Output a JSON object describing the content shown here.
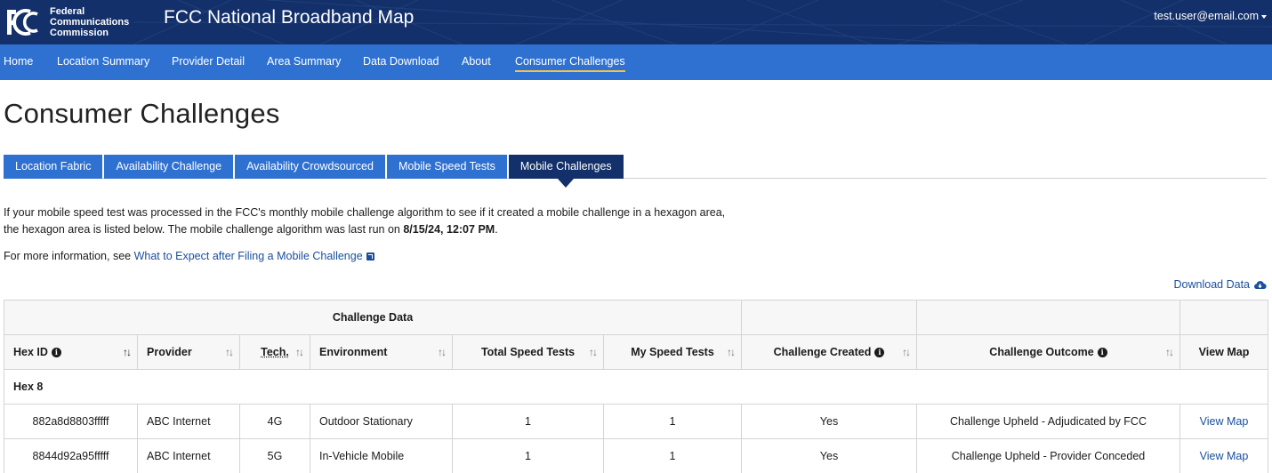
{
  "header": {
    "agency_lines": [
      "Federal",
      "Communications",
      "Commission"
    ],
    "app_title": "FCC National Broadband Map",
    "user_email": "test.user@email.com"
  },
  "nav": [
    {
      "label": "Home"
    },
    {
      "label": "Location Summary"
    },
    {
      "label": "Provider Detail"
    },
    {
      "label": "Area Summary"
    },
    {
      "label": "Data Download"
    },
    {
      "label": "About"
    },
    {
      "label": "Consumer Challenges",
      "active": true
    }
  ],
  "page": {
    "title": "Consumer Challenges",
    "tabs": [
      {
        "label": "Location Fabric"
      },
      {
        "label": "Availability Challenge"
      },
      {
        "label": "Availability Crowdsourced"
      },
      {
        "label": "Mobile Speed Tests"
      },
      {
        "label": "Mobile Challenges",
        "active": true
      }
    ],
    "description_pre": "If your mobile speed test was processed in the FCC's monthly mobile challenge algorithm to see if it created a mobile challenge in a hexagon area, the hexagon area is listed below. The mobile challenge algorithm was last run on ",
    "description_date": "8/15/24, 12:07 PM",
    "description_post": ".",
    "more_info_prefix": "For more information, see ",
    "more_info_link": "What to Expect after Filing a Mobile Challenge",
    "download_label": "Download Data"
  },
  "table": {
    "group_header": "Challenge Data",
    "columns": {
      "hex_id": "Hex ID",
      "provider": "Provider",
      "tech": "Tech.",
      "environment": "Environment",
      "total_speed_tests": "Total Speed Tests",
      "my_speed_tests": "My Speed Tests",
      "challenge_created": "Challenge Created",
      "challenge_outcome": "Challenge Outcome",
      "view_map": "View Map"
    },
    "sort_glyph": "↑↓",
    "group_label": "Hex 8",
    "rows": [
      {
        "hex_id": "882a8d8803fffff",
        "provider": "ABC Internet",
        "tech": "4G",
        "environment": "Outdoor Stationary",
        "total": "1",
        "mine": "1",
        "created": "Yes",
        "outcome": "Challenge Upheld - Adjudicated by FCC",
        "view": "View Map"
      },
      {
        "hex_id": "8844d92a95fffff",
        "provider": "ABC Internet",
        "tech": "5G",
        "environment": "In-Vehicle Mobile",
        "total": "1",
        "mine": "1",
        "created": "Yes",
        "outcome": "Challenge Upheld - Provider Conceded",
        "view": "View Map"
      }
    ]
  },
  "colors": {
    "header_bg": "#13306a",
    "nav_bg": "#2f71d1",
    "active_underline": "#f6c04a",
    "link": "#1a4f9c"
  },
  "icons": [
    "fcc-logo",
    "caret-down-icon",
    "external-link-icon",
    "cloud-download-icon",
    "info-icon",
    "sort-icon"
  ]
}
